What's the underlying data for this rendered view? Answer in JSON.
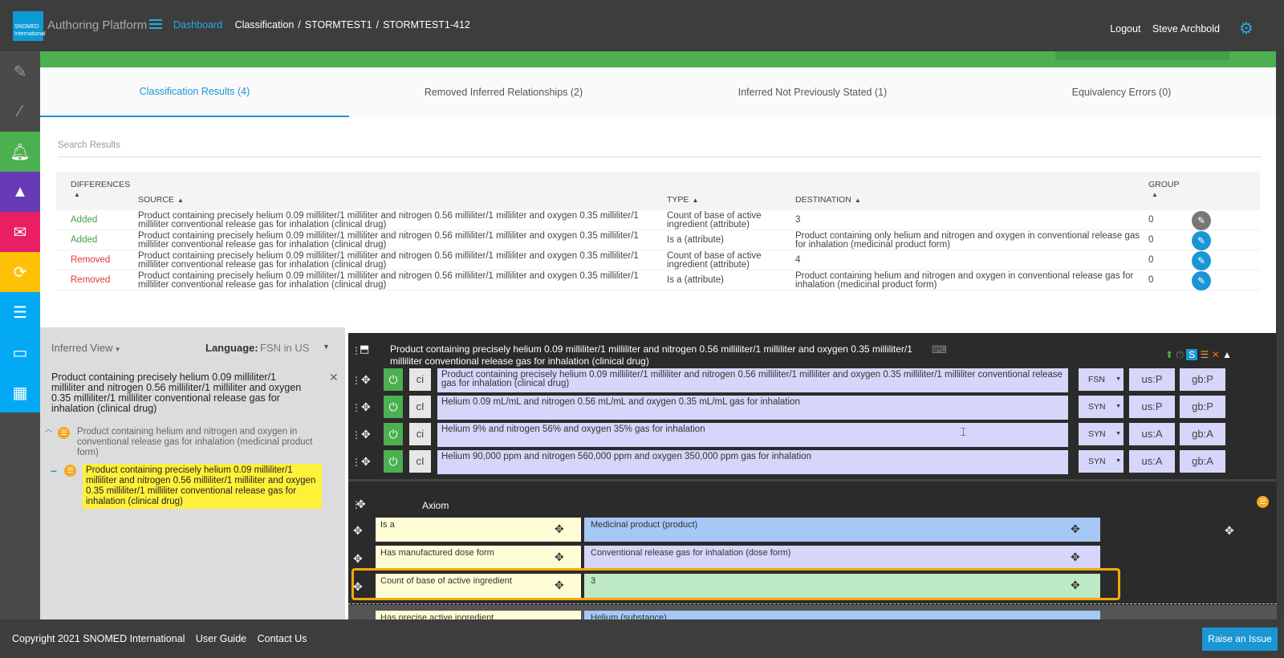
{
  "header": {
    "logo_text": "SNOMED International",
    "app_name": "Authoring Platform",
    "breadcrumbs": [
      "Dashboard",
      "Classification",
      "STORMTEST1",
      "STORMTEST1-412"
    ],
    "logout": "Logout",
    "user": "Steve Archbold"
  },
  "sidebar": {
    "icons": [
      "edit-icon",
      "wand-icon",
      "bell-icon",
      "graduation-cap-icon",
      "mail-icon",
      "sync-icon",
      "list-icon",
      "card-icon",
      "grid-icon"
    ],
    "colors": [
      "#4a4a4a",
      "#4a4a4a",
      "#4caf50",
      "#673ab7",
      "#e91e63",
      "#ffc107",
      "#03a9f4",
      "#03a9f4",
      "#03a9f4"
    ]
  },
  "tabs": [
    {
      "label": "Classification Results (4)",
      "active": true
    },
    {
      "label": "Removed Inferred Relationships (2)",
      "active": false
    },
    {
      "label": "Inferred Not Previously Stated (1)",
      "active": false
    },
    {
      "label": "Equivalency Errors (0)",
      "active": false
    }
  ],
  "search": {
    "placeholder": "Search Results"
  },
  "table": {
    "headers": {
      "differences": "DIFFERENCES",
      "source": "SOURCE",
      "type": "TYPE",
      "destination": "DESTINATION",
      "group": "GROUP"
    },
    "rows": [
      {
        "diff": "Added",
        "source": "Product containing precisely helium 0.09 milliliter/1 milliliter and nitrogen 0.56 milliliter/1 milliliter and oxygen 0.35 milliliter/1 milliliter conventional release gas for inhalation (clinical drug)",
        "type": "Count of base of active ingredient (attribute)",
        "destination": "3",
        "group": "0"
      },
      {
        "diff": "Added",
        "source": "Product containing precisely helium 0.09 milliliter/1 milliliter and nitrogen 0.56 milliliter/1 milliliter and oxygen 0.35 milliliter/1 milliliter conventional release gas for inhalation (clinical drug)",
        "type": "Is a (attribute)",
        "destination": "Product containing only helium and nitrogen and oxygen in conventional release gas for inhalation (medicinal product form)",
        "group": "0"
      },
      {
        "diff": "Removed",
        "source": "Product containing precisely helium 0.09 milliliter/1 milliliter and nitrogen 0.56 milliliter/1 milliliter and oxygen 0.35 milliliter/1 milliliter conventional release gas for inhalation (clinical drug)",
        "type": "Count of base of active ingredient (attribute)",
        "destination": "4",
        "group": "0"
      },
      {
        "diff": "Removed",
        "source": "Product containing precisely helium 0.09 milliliter/1 milliliter and nitrogen 0.56 milliliter/1 milliliter and oxygen 0.35 milliliter/1 milliliter conventional release gas for inhalation (clinical drug)",
        "type": "Is a (attribute)",
        "destination": "Product containing helium and nitrogen and oxygen in conventional release gas for inhalation (medicinal product form)",
        "group": "0"
      }
    ]
  },
  "left_panel": {
    "view": "Inferred View",
    "language_label": "Language:",
    "language_value": "FSN in US",
    "concept_title": "Product containing precisely helium 0.09 milliliter/1 milliliter and nitrogen 0.56 milliliter/1 milliliter and oxygen 0.35 milliliter/1 milliliter conventional release gas for inhalation (clinical drug)",
    "tree_parent": "Product containing helium and nitrogen and oxygen in conventional release gas for inhalation (medicinal product form)",
    "tree_child": "Product containing precisely helium 0.09 milliliter/1 milliliter and nitrogen 0.56 milliliter/1 milliliter and oxygen 0.35 milliliter/1 milliliter conventional release gas for inhalation (clinical drug)"
  },
  "editor": {
    "title": "Product containing precisely helium 0.09 milliliter/1 milliliter and nitrogen 0.56 milliliter/1 milliliter and oxygen 0.35 milliliter/1 milliliter conventional release gas for inhalation (clinical drug)",
    "descriptions": [
      {
        "case": "ci",
        "term": "Product containing precisely helium 0.09 milliliter/1 milliliter and nitrogen 0.56 milliliter/1 milliliter and oxygen 0.35 milliliter/1 milliliter conventional release gas for inhalation (clinical drug)",
        "type": "FSN",
        "us": "us:P",
        "gb": "gb:P"
      },
      {
        "case": "cI",
        "term": "Helium 0.09 mL/mL and nitrogen 0.56 mL/mL and oxygen 0.35 mL/mL gas for inhalation",
        "type": "SYN",
        "us": "us:P",
        "gb": "gb:P"
      },
      {
        "case": "ci",
        "term": "Helium 9% and nitrogen 56% and oxygen 35% gas for inhalation",
        "type": "SYN",
        "us": "us:A",
        "gb": "gb:A"
      },
      {
        "case": "cI",
        "term": "Helium 90,000 ppm and nitrogen 560,000 ppm and oxygen 350,000 ppm gas for inhalation",
        "type": "SYN",
        "us": "us:A",
        "gb": "gb:A"
      }
    ],
    "axiom_label": "Axiom",
    "relationships": [
      {
        "type": "Is a",
        "destination": "Medicinal product (product)"
      },
      {
        "type": "Has manufactured dose form",
        "destination": "Conventional release gas for inhalation (dose form)"
      },
      {
        "type": "Count of base of active ingredient",
        "destination": "3"
      },
      {
        "type": "Has precise active ingredient",
        "destination": "Helium (substance)"
      }
    ]
  },
  "footer": {
    "copyright": "Copyright 2021 SNOMED International",
    "user_guide": "User Guide",
    "contact": "Contact Us",
    "raise_issue": "Raise an Issue"
  }
}
